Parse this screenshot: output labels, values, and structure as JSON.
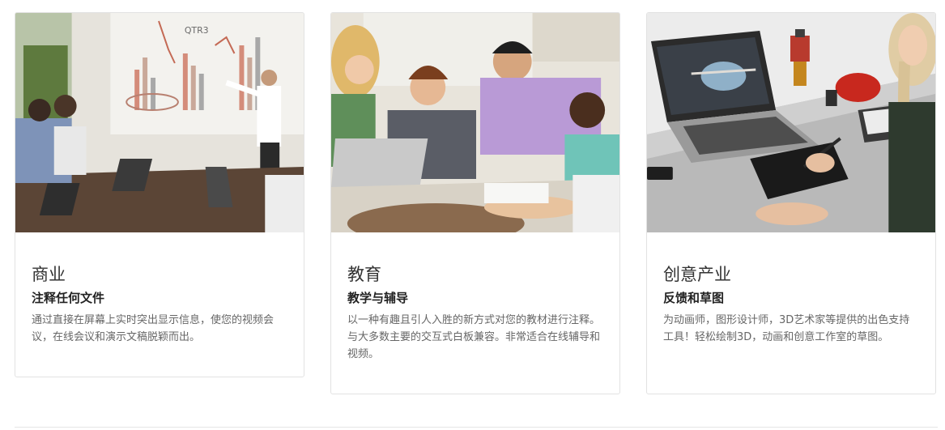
{
  "cards": [
    {
      "title": "商业",
      "subtitle": "注释任何文件",
      "text": "通过直接在屏幕上实时突出显示信息，使您的视频会议，在线会议和演示文稿脱颖而出。",
      "image_icon": "business-presentation-photo",
      "slide_text": "QTR3"
    },
    {
      "title": "教育",
      "subtitle": "教学与辅导",
      "text": "以一种有趣且引人入胜的新方式对您的教材进行注释。与大多数主要的交互式白板兼容。非常适合在线辅导和视频。",
      "image_icon": "education-classroom-photo"
    },
    {
      "title": "创意产业",
      "subtitle": "反馈和草图",
      "text": "为动画师，图形设计师，3D艺术家等提供的出色支持工具！轻松绘制3D，动画和创意工作室的草图。",
      "image_icon": "creative-studio-photo"
    }
  ],
  "colors": {
    "card_border": "#e2e2e2",
    "title": "#333333",
    "subtitle": "#222222",
    "text": "#666666"
  }
}
